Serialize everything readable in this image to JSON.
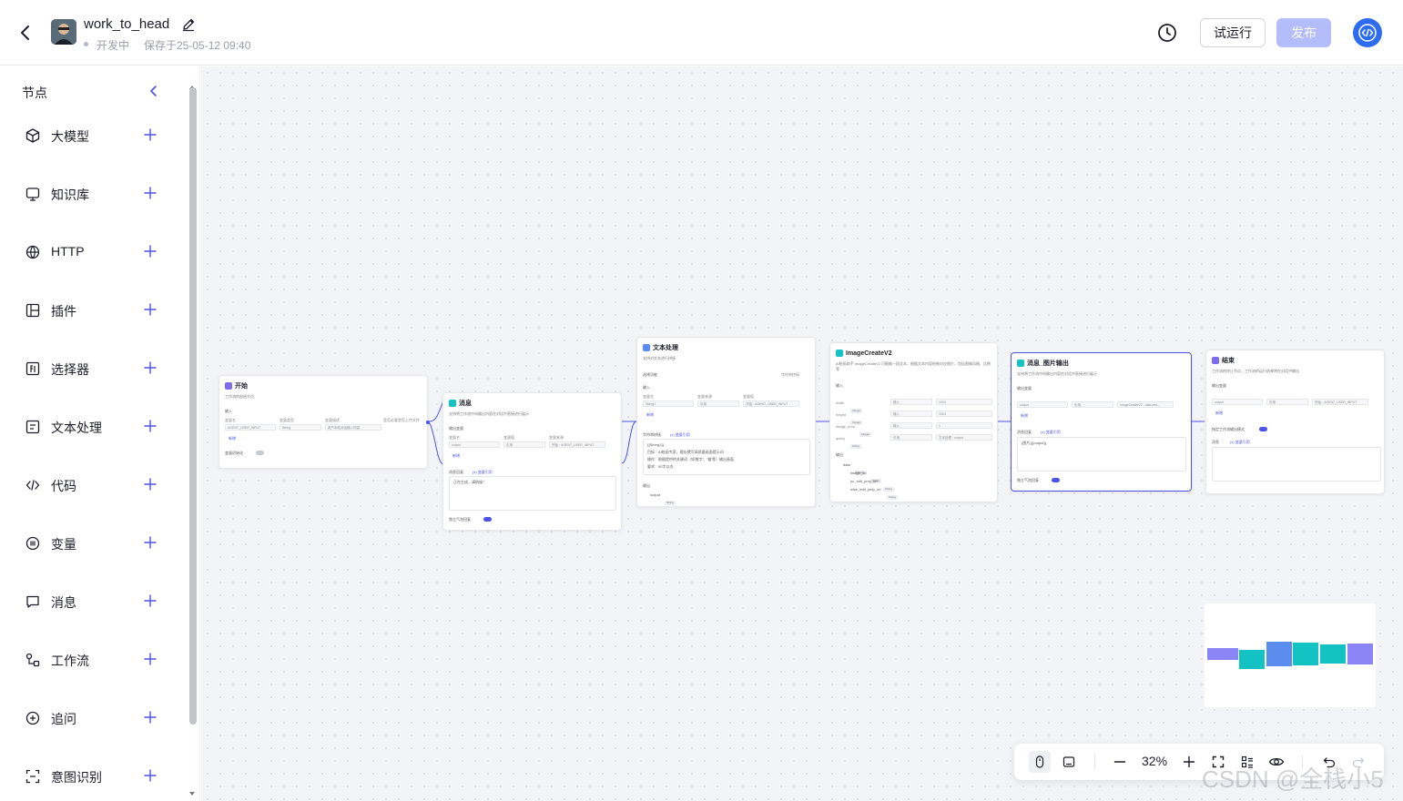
{
  "header": {
    "title": "work_to_head",
    "status": "开发中",
    "saved": "保存于25-05-12 09:40",
    "trial_run_label": "试运行",
    "publish_label": "发布"
  },
  "sidebar": {
    "title": "节点",
    "items": [
      {
        "label": "大模型",
        "icon": "cube-icon"
      },
      {
        "label": "知识库",
        "icon": "database-icon"
      },
      {
        "label": "HTTP",
        "icon": "globe-icon"
      },
      {
        "label": "插件",
        "icon": "plugin-icon"
      },
      {
        "label": "选择器",
        "icon": "selector-icon"
      },
      {
        "label": "文本处理",
        "icon": "text-process-icon"
      },
      {
        "label": "代码",
        "icon": "code-icon"
      },
      {
        "label": "变量",
        "icon": "variable-icon"
      },
      {
        "label": "消息",
        "icon": "message-icon"
      },
      {
        "label": "工作流",
        "icon": "workflow-icon"
      },
      {
        "label": "追问",
        "icon": "followup-icon"
      },
      {
        "label": "意图识别",
        "icon": "intent-icon"
      }
    ]
  },
  "canvas": {
    "nodes": {
      "start": {
        "title": "开始",
        "desc": "工作流的起始节点",
        "input_label": "输入",
        "col1": "变量名",
        "col2": "变量类型",
        "col3": "变量描述",
        "col4": "是否必要",
        "col5": "是否上传文件",
        "var": "AGENT_USER_INPUT",
        "type": "String",
        "placeholder": "用户本轮对话输入内容",
        "add": "新增",
        "toggle_label": "变量初始化"
      },
      "msg1": {
        "title": "消息",
        "desc": "支持将工作流中间输出内容在对话中直接进行展示",
        "out_label": "输出变量",
        "col1": "变量名",
        "col2": "变量值",
        "col3": "变量来源",
        "var": "output",
        "source": "引用",
        "value": "开始 · AGENT_USER_INPUT",
        "add": "新增",
        "msg_label": "消息回复",
        "ref": "(x) 变量引用",
        "content": "正在生成，请稍候！",
        "toggle_label": "独立气泡回复"
      },
      "text": {
        "title": "文本处理",
        "desc": "支持对文本进行拼接",
        "mode_label": "选择功能",
        "mode_value": "字符串拼接",
        "input_label": "输入",
        "col1": "变量名",
        "col2": "变量来源",
        "col3": "变量值",
        "var": "String1",
        "source": "引用",
        "value": "开始 · AGENT_USER_INPUT",
        "add": "新增",
        "concat_label": "字符串拼接",
        "ref": "(x) 变量引用",
        "line1": "{{String1}}",
        "line2": "目标：AI绘画专家，擅长撰写高质量画面提示词",
        "line3": "操作：根据提供的关键词（如'数字'、'猫'等）输出画面",
        "line4": "要求：50字以内",
        "out_label": "输出",
        "out_var": "output",
        "out_type": "String"
      },
      "image": {
        "title": "ImageCreateV2",
        "desc": "AI绘画助手 ImageCreateV2 可根据一段文本，根据文本内容绘制对应图片，包括图像风格、比例等",
        "input_label": "输入",
        "rows": [
          {
            "name": "width",
            "type": "Integer",
            "source": "输入",
            "value": "1024"
          },
          {
            "name": "height",
            "type": "Integer",
            "source": "输入",
            "value": "1024"
          },
          {
            "name": "image_num",
            "type": "Integer",
            "source": "输入",
            "value": "1"
          },
          {
            "name": "query",
            "type": "String",
            "source": "引用",
            "value": "文本处理 · output"
          }
        ],
        "out_label": "输出",
        "out_data": "data",
        "out_data_type": "Object",
        "out_fields": [
          {
            "name": "image_url",
            "type": "String"
          },
          {
            "name": "pc_edit_pmp_url",
            "type": "String"
          },
          {
            "name": "wise_edit_pmp_url",
            "type": "String"
          }
        ]
      },
      "msg2": {
        "title": "消息_图片输出",
        "desc": "支持将工作流中间输出内容在对话中直接进行展示",
        "out_label": "输出变量",
        "var": "output",
        "source": "引用",
        "value": "ImageCreateV2 · data.ima...",
        "add": "新增",
        "msg_label": "消息回复",
        "ref": "(x) 变量引用",
        "content": "{图片}{{output}}",
        "toggle_label": "独立气泡回复"
      },
      "end": {
        "title": "结束",
        "desc": "工作流的终止节点，工作流的运行结果将在对话中输出",
        "out_label": "输出变量",
        "var": "output",
        "source": "引用",
        "value": "开始 · AGENT_USER_INPUT",
        "add": "新增",
        "mode_label": "指定工作流输出模式",
        "msg_label": "消息",
        "ref": "(x) 变量引用"
      }
    }
  },
  "minimap": {
    "blocks": [
      {
        "color": "#8b84f5"
      },
      {
        "color": "#13c2c2"
      },
      {
        "color": "#5b8def"
      },
      {
        "color": "#13c2c2"
      },
      {
        "color": "#13c2c2"
      },
      {
        "color": "#8b84f5"
      }
    ]
  },
  "toolbar": {
    "zoom": "32%"
  },
  "watermark": "CSDN @全栈小5",
  "colors": {
    "accent": "#4d53e8",
    "publish_disabled": "#b4bdfa",
    "code_view": "#2d6cf0"
  }
}
